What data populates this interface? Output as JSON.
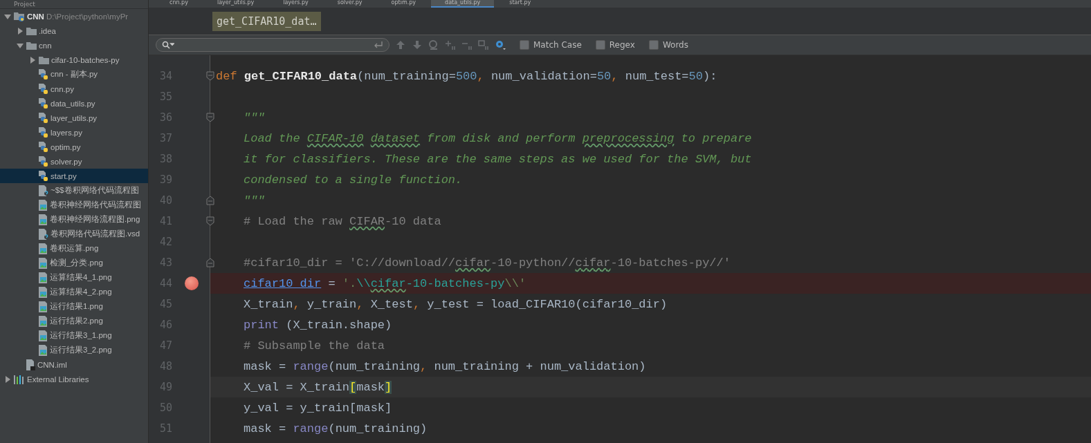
{
  "sidebar": {
    "title": "Project",
    "tree": [
      {
        "label": "CNN",
        "hint": "D:\\Project\\python\\myPr",
        "kind": "project",
        "expanded": true,
        "selected": false,
        "children": [
          {
            "label": ".idea",
            "kind": "folder",
            "expanded": false,
            "selected": false
          },
          {
            "label": "cnn",
            "kind": "folder",
            "expanded": true,
            "selected": false,
            "children": [
              {
                "label": "cifar-10-batches-py",
                "kind": "folder",
                "expanded": false,
                "selected": false
              },
              {
                "label": "cnn - 副本.py",
                "kind": "python",
                "selected": false
              },
              {
                "label": "cnn.py",
                "kind": "python",
                "selected": false
              },
              {
                "label": "data_utils.py",
                "kind": "python",
                "selected": false
              },
              {
                "label": "layer_utils.py",
                "kind": "python",
                "selected": false
              },
              {
                "label": "layers.py",
                "kind": "python",
                "selected": false
              },
              {
                "label": "optim.py",
                "kind": "python",
                "selected": false
              },
              {
                "label": "solver.py",
                "kind": "python",
                "selected": false
              },
              {
                "label": "start.py",
                "kind": "python",
                "selected": true
              },
              {
                "label": "~$$卷积网络代码流程图",
                "kind": "unknown",
                "selected": false
              },
              {
                "label": "卷积神经网络代码流程图",
                "kind": "image",
                "selected": false
              },
              {
                "label": "卷积神经网络流程图.png",
                "kind": "image",
                "selected": false
              },
              {
                "label": "卷积网络代码流程图.vsd",
                "kind": "unknown",
                "selected": false
              },
              {
                "label": "卷积运算.png",
                "kind": "image",
                "selected": false
              },
              {
                "label": "检测_分类.png",
                "kind": "image",
                "selected": false
              },
              {
                "label": "运算结果4_1.png",
                "kind": "image",
                "selected": false
              },
              {
                "label": "运算结果4_2.png",
                "kind": "image",
                "selected": false
              },
              {
                "label": "运行结果1.png",
                "kind": "image",
                "selected": false
              },
              {
                "label": "运行结果2.png",
                "kind": "image",
                "selected": false
              },
              {
                "label": "运行结果3_1.png",
                "kind": "image",
                "selected": false
              },
              {
                "label": "运行结果3_2.png",
                "kind": "image",
                "selected": false
              }
            ]
          },
          {
            "label": "CNN.iml",
            "kind": "module",
            "selected": false
          }
        ]
      },
      {
        "label": "External Libraries",
        "kind": "libraries",
        "expanded": false,
        "selected": false
      }
    ]
  },
  "tabs": [
    {
      "label": "cnn.py",
      "selected": false
    },
    {
      "label": "layer_utils.py",
      "selected": false
    },
    {
      "label": "layers.py",
      "selected": false
    },
    {
      "label": "solver.py",
      "selected": false
    },
    {
      "label": "optim.py",
      "selected": false
    },
    {
      "label": "data_utils.py",
      "selected": true
    },
    {
      "label": "start.py",
      "selected": false
    }
  ],
  "breadcrumb": "get_CIFAR10_dat…",
  "find_bar": {
    "options": [
      {
        "label": "Match Case",
        "checked": false
      },
      {
        "label": "Regex",
        "checked": false
      },
      {
        "label": "Words",
        "checked": false
      }
    ]
  },
  "code_lines": [
    {
      "number": "34",
      "fold_start": true,
      "tokens": [
        {
          "kind": "keyword",
          "text": "def "
        },
        {
          "kind": "func",
          "text": "get_CIFAR10_data"
        },
        {
          "kind": "plain",
          "text": "(num_training="
        },
        {
          "kind": "num",
          "text": "500"
        },
        {
          "kind": "keyword",
          "text": ", "
        },
        {
          "kind": "plain",
          "text": "num_validation="
        },
        {
          "kind": "num",
          "text": "50"
        },
        {
          "kind": "keyword",
          "text": ", "
        },
        {
          "kind": "plain",
          "text": "num_test="
        },
        {
          "kind": "num",
          "text": "50"
        },
        {
          "kind": "plain",
          "text": "):"
        }
      ]
    },
    {
      "number": "35"
    },
    {
      "number": "36",
      "fold_start": true,
      "indented": true,
      "tokens": [
        {
          "kind": "doc",
          "text": "\"\"\""
        }
      ]
    },
    {
      "number": "37",
      "indented": true,
      "tokens": [
        {
          "kind": "doc",
          "text": "Load the "
        },
        {
          "kind": "doc",
          "text": "CIFAR-10",
          "squiggle": true
        },
        {
          "kind": "doc",
          "text": " dataset",
          "squiggle": true
        },
        {
          "kind": "doc",
          "text": " from disk and perform "
        },
        {
          "kind": "doc",
          "text": "preprocessing",
          "squiggle": true
        },
        {
          "kind": "doc",
          "text": " to prepare"
        }
      ]
    },
    {
      "number": "38",
      "indented": true,
      "tokens": [
        {
          "kind": "doc",
          "text": "it for classifiers. These are the same steps as we used for the SVM, but"
        }
      ]
    },
    {
      "number": "39",
      "indented": true,
      "tokens": [
        {
          "kind": "doc",
          "text": "condensed to a single function."
        }
      ]
    },
    {
      "number": "40",
      "fold_end": true,
      "indented": true,
      "tokens": [
        {
          "kind": "doc",
          "text": "\"\"\""
        }
      ]
    },
    {
      "number": "41",
      "fold_start": true,
      "indented": true,
      "tokens": [
        {
          "kind": "comment",
          "text": "# Load the raw "
        },
        {
          "kind": "comment",
          "text": "CIFAR",
          "squiggle": true
        },
        {
          "kind": "comment",
          "text": "-10 data"
        }
      ]
    },
    {
      "number": "42"
    },
    {
      "number": "43",
      "fold_end": true,
      "indented": true,
      "tokens": [
        {
          "kind": "comment",
          "text": "#cifar10_dir = 'C://download//"
        },
        {
          "kind": "comment",
          "text": "cifar",
          "squiggle": true
        },
        {
          "kind": "comment",
          "text": "-10-python//"
        },
        {
          "kind": "comment",
          "text": "cifar",
          "squiggle": true
        },
        {
          "kind": "comment",
          "text": "-10-batches-py//'"
        }
      ]
    },
    {
      "number": "44",
      "breakpoint": true,
      "indented": true,
      "tokens": [
        {
          "kind": "link",
          "text": "cifar10_dir"
        },
        {
          "kind": "plain",
          "text": " = "
        },
        {
          "kind": "string",
          "text": "'."
        },
        {
          "kind": "escape",
          "text": "\\\\"
        },
        {
          "kind": "escape",
          "text": "cifar",
          "squiggle": true
        },
        {
          "kind": "escape",
          "text": "-10-batches-py"
        },
        {
          "kind": "string",
          "text": "\\\\'"
        }
      ]
    },
    {
      "number": "45",
      "indented": true,
      "tokens": [
        {
          "kind": "plain",
          "text": "X_train"
        },
        {
          "kind": "keyword",
          "text": ", "
        },
        {
          "kind": "plain",
          "text": "y_train"
        },
        {
          "kind": "keyword",
          "text": ", "
        },
        {
          "kind": "plain",
          "text": "X_test"
        },
        {
          "kind": "keyword",
          "text": ", "
        },
        {
          "kind": "plain",
          "text": "y_test = load_CIFAR10(cifar10_dir)"
        }
      ]
    },
    {
      "number": "46",
      "indented": true,
      "tokens": [
        {
          "kind": "builtin",
          "text": "print"
        },
        {
          "kind": "plain",
          "text": " (X_train.shape)"
        }
      ]
    },
    {
      "number": "47",
      "indented": true,
      "tokens": [
        {
          "kind": "comment",
          "text": "# Subsample the data"
        }
      ]
    },
    {
      "number": "48",
      "indented": true,
      "tokens": [
        {
          "kind": "plain",
          "text": "mask = "
        },
        {
          "kind": "builtin",
          "text": "range"
        },
        {
          "kind": "plain",
          "text": "(num_training"
        },
        {
          "kind": "keyword",
          "text": ", "
        },
        {
          "kind": "plain",
          "text": "num_training + num_validation)"
        }
      ]
    },
    {
      "number": "49",
      "current": true,
      "indented": true,
      "tokens": [
        {
          "kind": "plain",
          "text": "X_val = X_train"
        },
        {
          "kind": "match",
          "text": "["
        },
        {
          "kind": "plain",
          "text": "mask"
        },
        {
          "kind": "match",
          "text": "]"
        }
      ]
    },
    {
      "number": "50",
      "indented": true,
      "tokens": [
        {
          "kind": "plain",
          "text": "y_val = y_train[mask]"
        }
      ]
    },
    {
      "number": "51",
      "indented": true,
      "tokens": [
        {
          "kind": "plain",
          "text": "mask = "
        },
        {
          "kind": "builtin",
          "text": "range"
        },
        {
          "kind": "plain",
          "text": "(num_training)"
        }
      ]
    }
  ]
}
